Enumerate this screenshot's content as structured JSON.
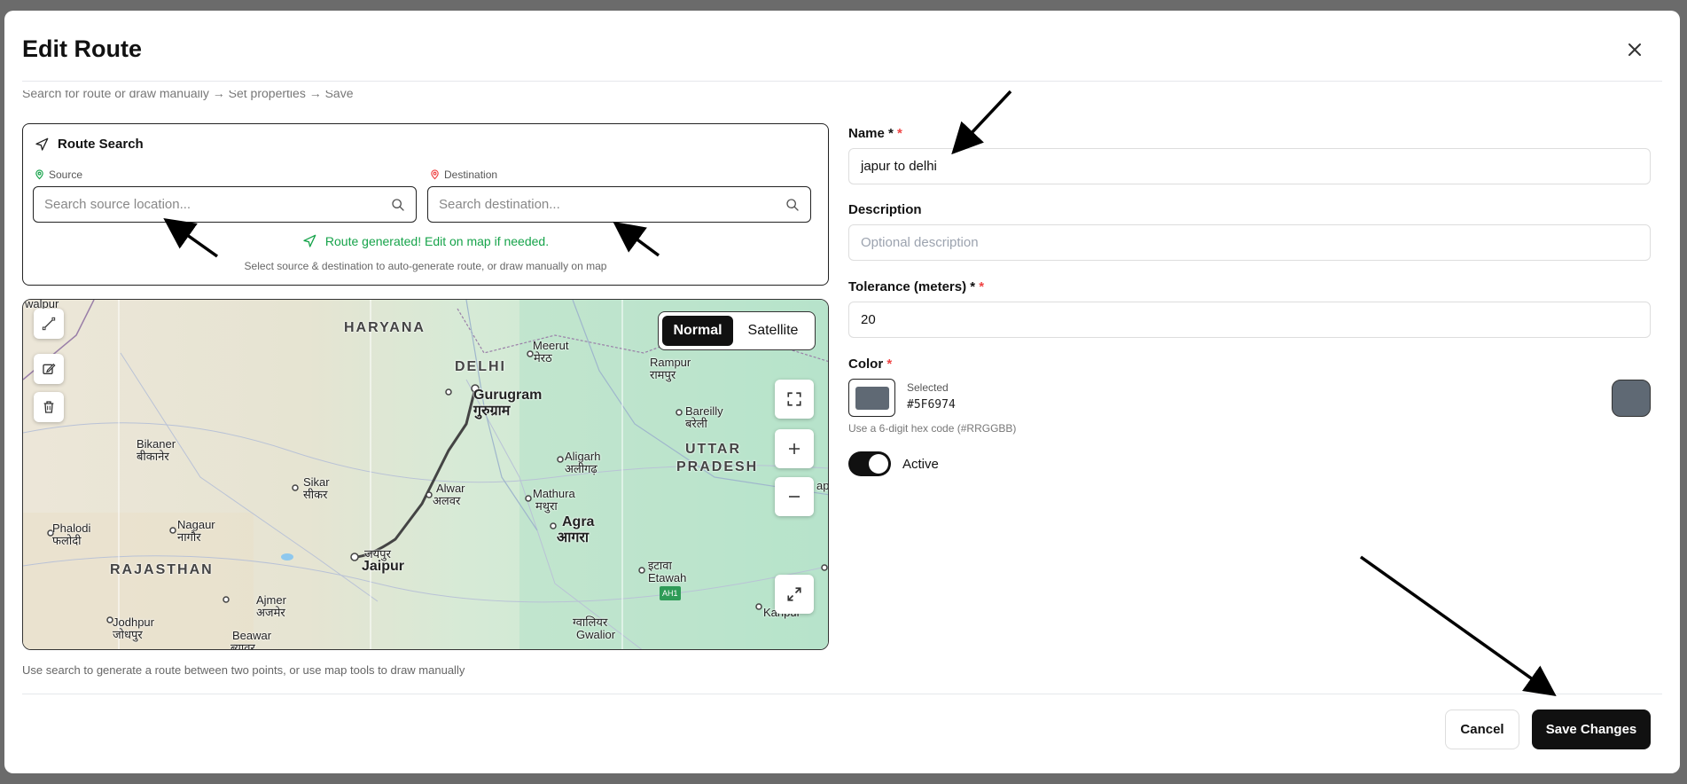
{
  "dialog": {
    "title": "Edit Route",
    "subtitle": "Search for route or draw manually → Set properties → Save"
  },
  "route_search": {
    "heading": "Route Search",
    "source_label": "Source",
    "source_placeholder": "Search source location...",
    "destination_label": "Destination",
    "destination_placeholder": "Search destination...",
    "status": "Route generated! Edit on map if needed.",
    "hint": "Select source & destination to auto-generate route, or draw manually on map"
  },
  "map": {
    "view_modes": [
      "Normal",
      "Satellite"
    ],
    "selected_view": "Normal",
    "caption": "Use search to generate a route between two points, or use map tools to draw manually",
    "labels": {
      "walpur": "walpur",
      "haryana": "HARYANA",
      "delhi": "DELHI",
      "meerut": "Meerut",
      "meerut_hi": "मेरठ",
      "rampur": "Rampur",
      "rampur_hi": "रामपुर",
      "gurugram": "Gurugram",
      "gurugram_hi": "गुरुग्राम",
      "bareilly": "Bareilly",
      "bareilly_hi": "बरेली",
      "bikaner": "Bikaner",
      "bikaner_hi": "बीकानेर",
      "aligarh": "Aligarh",
      "aligarh_hi": "अलीगढ़",
      "uttar": "UTTAR",
      "pradesh": "PRADESH",
      "sikar": "Sikar",
      "sikar_hi": "सीकर",
      "alwar": "Alwar",
      "alwar_hi": "अलवर",
      "mathura": "Mathura",
      "mathura_hi": "मथुरा",
      "phalodi": "Phalodi",
      "phalodi_hi": "फलोदी",
      "nagaur": "Nagaur",
      "nagaur_hi": "नागौर",
      "agra": "Agra",
      "agra_hi": "आगरा",
      "rajasthan": "RAJASTHAN",
      "jaipur_hi": "जयपुर",
      "jaipur": "Jaipur",
      "etawah_hi": "इटावा",
      "etawah": "Etawah",
      "ah1": "AH1",
      "ajmer": "Ajmer",
      "ajmer_hi": "अजमेर",
      "jodhpur": "Jodhpur",
      "jodhpur_hi": "जोधपुर",
      "gwalior_hi": "ग्वालियर",
      "gwalior": "Gwalior",
      "beawar": "Beawar",
      "beawar_hi": "ब्यावर",
      "kanpur": "Kanpur",
      "lucknow_partial": "ap"
    }
  },
  "form": {
    "name_label": "Name *",
    "name_value": "japur to delhi",
    "description_label": "Description",
    "description_placeholder": "Optional description",
    "tolerance_label": "Tolerance (meters) *",
    "tolerance_value": "20",
    "color_label": "Color",
    "selected_label": "Selected",
    "color_hex": "#5F6974",
    "color_hint": "Use a 6-digit hex code (#RRGGBB)",
    "active_label": "Active",
    "active": true,
    "required_mark": "*"
  },
  "footer": {
    "cancel_label": "Cancel",
    "save_label": "Save Changes"
  },
  "colors": {
    "route_color": "#5F6974",
    "success": "#16a34a",
    "required": "#ef4444",
    "primary": "#111111"
  }
}
